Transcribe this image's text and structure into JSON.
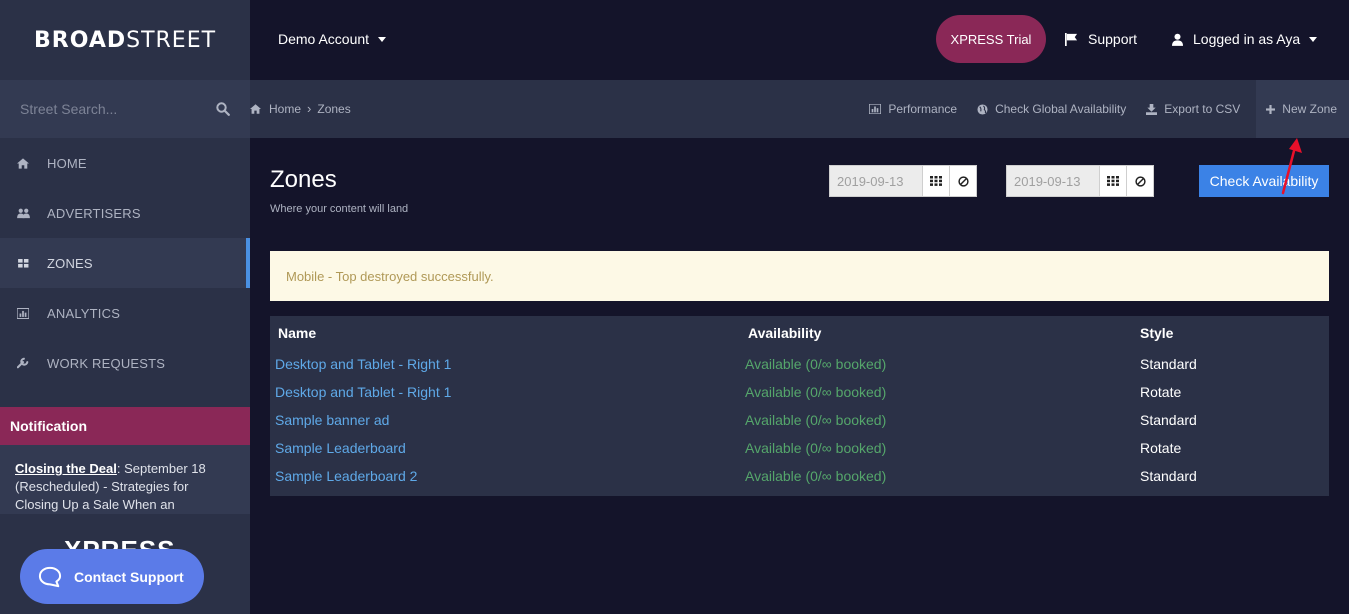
{
  "brand": {
    "logo_bold": "BROAD",
    "logo_light": "STREET"
  },
  "sidebar": {
    "search_placeholder": "Street Search...",
    "items": [
      {
        "label": "HOME",
        "icon": "home-icon"
      },
      {
        "label": "ADVERTISERS",
        "icon": "users-icon"
      },
      {
        "label": "ZONES",
        "icon": "grid-icon",
        "active": true
      },
      {
        "label": "ANALYTICS",
        "icon": "chart-icon"
      },
      {
        "label": "WORK REQUESTS",
        "icon": "wrench-icon"
      }
    ],
    "notification": {
      "title": "Notification",
      "link": "Closing the Deal",
      "text": ": September 18 (Rescheduled) - Strategies for Closing Up a Sale When an"
    },
    "xpress_peek": "XPRESS",
    "contact_support": "Contact Support"
  },
  "topbar": {
    "account": "Demo Account",
    "xpress_trial": "XPRESS Trial",
    "support": "Support",
    "user": "Logged in as Aya"
  },
  "breadcrumb": {
    "home": "Home",
    "sep": "›",
    "current": "Zones"
  },
  "actions": {
    "performance": "Performance",
    "global_availability": "Check Global Availability",
    "export_csv": "Export to CSV",
    "new_zone": "New Zone"
  },
  "page": {
    "title": "Zones",
    "subtitle": "Where your content will land",
    "start_date": "2019-09-13",
    "end_date": "2019-09-13",
    "check_button": "Check Availability"
  },
  "alert": "Mobile - Top destroyed successfully.",
  "table": {
    "headers": [
      "Name",
      "Availability",
      "Style"
    ],
    "rows": [
      {
        "name": "Desktop and Tablet - Right 1",
        "availability": "Available (0/∞ booked)",
        "style": "Standard"
      },
      {
        "name": "Desktop and Tablet - Right 1",
        "availability": "Available (0/∞ booked)",
        "style": "Rotate"
      },
      {
        "name": "Sample banner ad",
        "availability": "Available (0/∞ booked)",
        "style": "Standard"
      },
      {
        "name": "Sample Leaderboard",
        "availability": "Available (0/∞ booked)",
        "style": "Rotate"
      },
      {
        "name": "Sample Leaderboard 2",
        "availability": "Available (0/∞ booked)",
        "style": "Standard"
      }
    ]
  },
  "colors": {
    "sidebar_bg": "#2b3147",
    "page_bg": "#14142a",
    "accent_magenta": "#8a2857",
    "primary_blue": "#3b82e6",
    "link_blue": "#5fa9e8",
    "available_green": "#55a66b",
    "annotation_arrow": "#e8102a"
  }
}
